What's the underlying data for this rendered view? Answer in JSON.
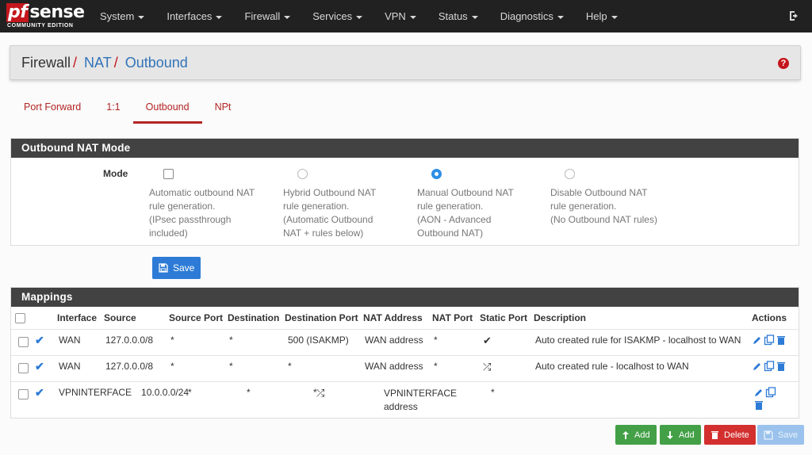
{
  "brand": {
    "logo_prefix": "pf",
    "logo_suffix": "sense",
    "tagline": "COMMUNITY EDITION"
  },
  "nav": {
    "items": [
      "System",
      "Interfaces",
      "Firewall",
      "Services",
      "VPN",
      "Status",
      "Diagnostics",
      "Help"
    ]
  },
  "breadcrumb": {
    "root": "Firewall",
    "level2": "NAT",
    "current": "Outbound",
    "separator": "/"
  },
  "help_label": "?",
  "tabs": [
    "Port Forward",
    "1:1",
    "Outbound",
    "NPt"
  ],
  "mode_panel": {
    "title": "Outbound NAT Mode",
    "label": "Mode",
    "options": [
      {
        "lines": [
          "Automatic outbound NAT",
          "rule generation.",
          "(IPsec passthrough",
          "included)"
        ],
        "selected": false,
        "control": "checkbox"
      },
      {
        "lines": [
          "Hybrid Outbound NAT",
          "rule generation.",
          "(Automatic Outbound",
          "NAT + rules below)"
        ],
        "selected": false,
        "control": "radio"
      },
      {
        "lines": [
          "Manual Outbound NAT",
          "rule generation.",
          "(AON - Advanced",
          "Outbound NAT)"
        ],
        "selected": true,
        "control": "radio"
      },
      {
        "lines": [
          "Disable Outbound NAT",
          "rule generation.",
          "(No Outbound NAT rules)"
        ],
        "selected": false,
        "control": "radio"
      }
    ],
    "save_label": "Save"
  },
  "mappings": {
    "title": "Mappings",
    "columns": [
      "Interface",
      "Source",
      "Source Port",
      "Destination",
      "Destination Port",
      "NAT Address",
      "NAT Port",
      "Static Port",
      "Description",
      "Actions"
    ],
    "rows": [
      {
        "interface": "WAN",
        "source": "127.0.0.0/8",
        "source_port": "*",
        "destination": "*",
        "destination_port": "500 (ISAKMP)",
        "nat_address": "WAN address",
        "nat_port": "*",
        "static_port": "check",
        "description": "Auto created rule for ISAKMP - localhost to WAN"
      },
      {
        "interface": "WAN",
        "source": "127.0.0.0/8",
        "source_port": "*",
        "destination": "*",
        "destination_port": "*",
        "nat_address": "WAN address",
        "nat_port": "*",
        "static_port": "random",
        "description": "Auto created rule - localhost to WAN"
      },
      {
        "interface": "VPNINTERFACE",
        "source": "10.0.0.0/24",
        "source_port": "*",
        "destination": "*",
        "destination_port": "*",
        "nat_address_line1": "VPNINTERFACE",
        "nat_address_line2": "address",
        "nat_port": "*",
        "static_port": "random",
        "description": ""
      }
    ]
  },
  "bottom_buttons": {
    "add_top": "Add",
    "add_bottom": "Add",
    "delete": "Delete",
    "save": "Save"
  },
  "colors": {
    "navbar": "#212121",
    "accent_red": "#c4161c",
    "link_blue": "#3273b8",
    "primary": "#2d7bd6",
    "success": "#43a047",
    "danger": "#d32f2f"
  }
}
